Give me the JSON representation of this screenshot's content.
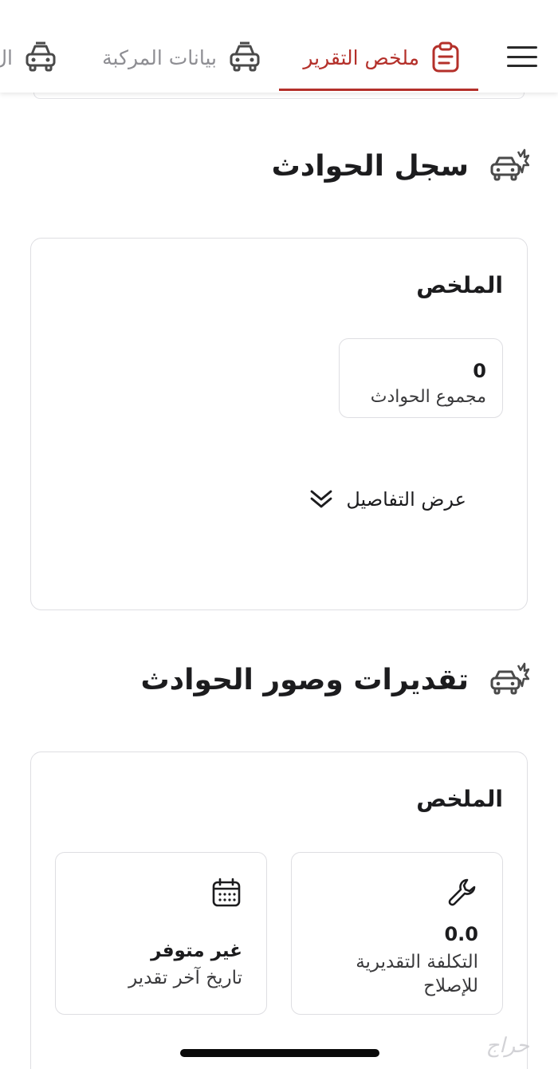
{
  "tabs": [
    {
      "label": "ملخص التقرير",
      "icon": "report-clipboard-icon",
      "active": true
    },
    {
      "label": "بيانات المركبة",
      "icon": "car-icon",
      "active": false
    },
    {
      "label": "ال",
      "icon": "car-icon",
      "active": false
    }
  ],
  "accent_color": "#b4302a",
  "accident_history": {
    "title": "سجل الحوادث",
    "icon": "car-crash-icon",
    "summary_title": "الملخص",
    "total_value": "0",
    "total_label": "مجموع الحوادث",
    "details_label": "عرض التفاصيل",
    "details_icon": "double-chevron-down-icon"
  },
  "estimates": {
    "title": "تقديرات وصور الحوادث",
    "icon": "car-crash-icon",
    "summary_title": "الملخص",
    "cost_value": "0.0",
    "cost_label": "التكلفة التقديرية للإصلاح",
    "cost_icon": "wrench-icon",
    "date_value": "غير متوفر",
    "date_label": "تاريخ آخر تقدير",
    "date_icon": "calendar-icon"
  },
  "watermark": "حراج"
}
